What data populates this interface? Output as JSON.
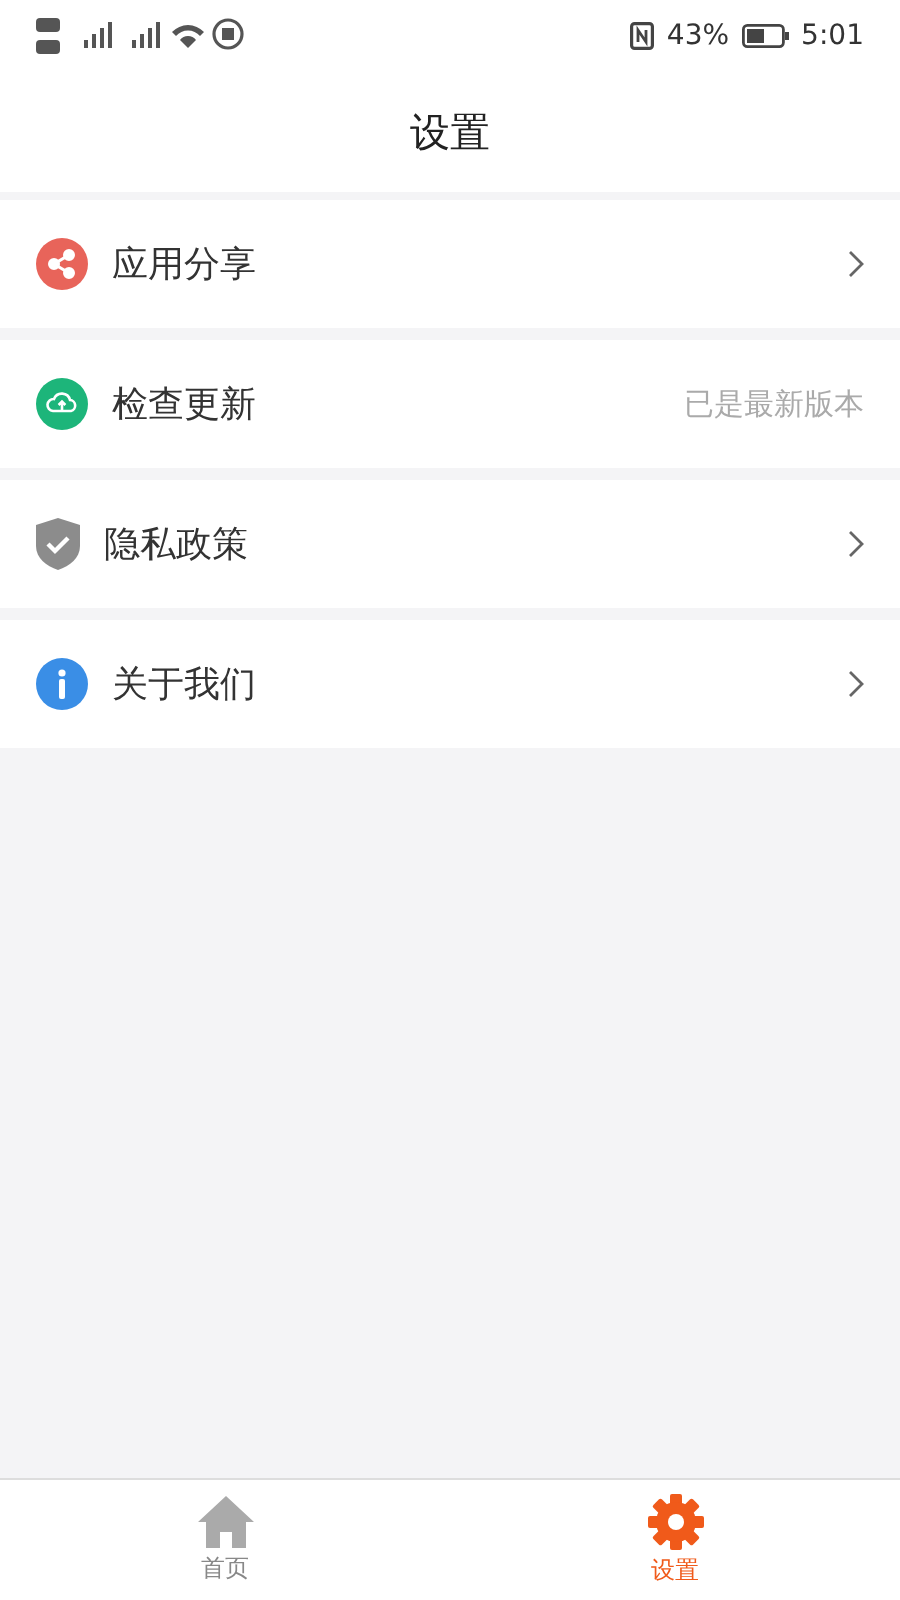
{
  "status_bar": {
    "battery": "43%",
    "time": "5:01"
  },
  "header": {
    "title": "设置"
  },
  "items": [
    {
      "kind": "chevron",
      "label": "应用分享"
    },
    {
      "kind": "status",
      "label": "检查更新",
      "status": "已是最新版本"
    },
    {
      "kind": "chevron",
      "label": "隐私政策"
    },
    {
      "kind": "chevron",
      "label": "关于我们"
    }
  ],
  "tabs": [
    {
      "label": "首页",
      "selected": false
    },
    {
      "label": "设置",
      "selected": true
    }
  ]
}
